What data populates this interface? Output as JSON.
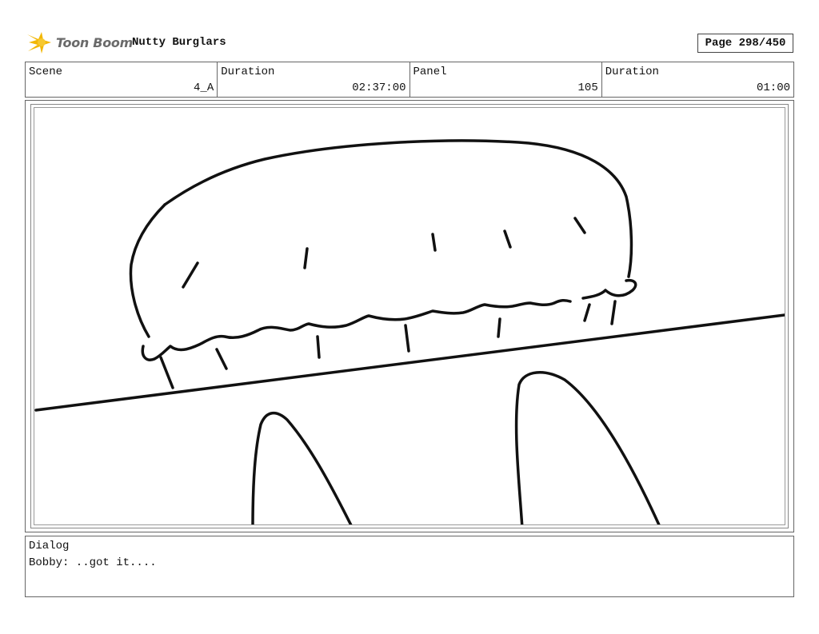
{
  "header": {
    "logo_text": "Toon Boom",
    "project_title": "Nutty Burglars",
    "page": "Page 298/450"
  },
  "info": {
    "scene_label": "Scene",
    "scene_value": "4_A",
    "scene_duration_label": "Duration",
    "scene_duration_value": "02:37:00",
    "panel_label": "Panel",
    "panel_value": "105",
    "panel_duration_label": "Duration",
    "panel_duration_value": "01:00"
  },
  "dialog": {
    "label": "Dialog",
    "text": "Bobby: ..got it...."
  },
  "colors": {
    "logo_star": "#f2b705",
    "line": "#111111"
  }
}
